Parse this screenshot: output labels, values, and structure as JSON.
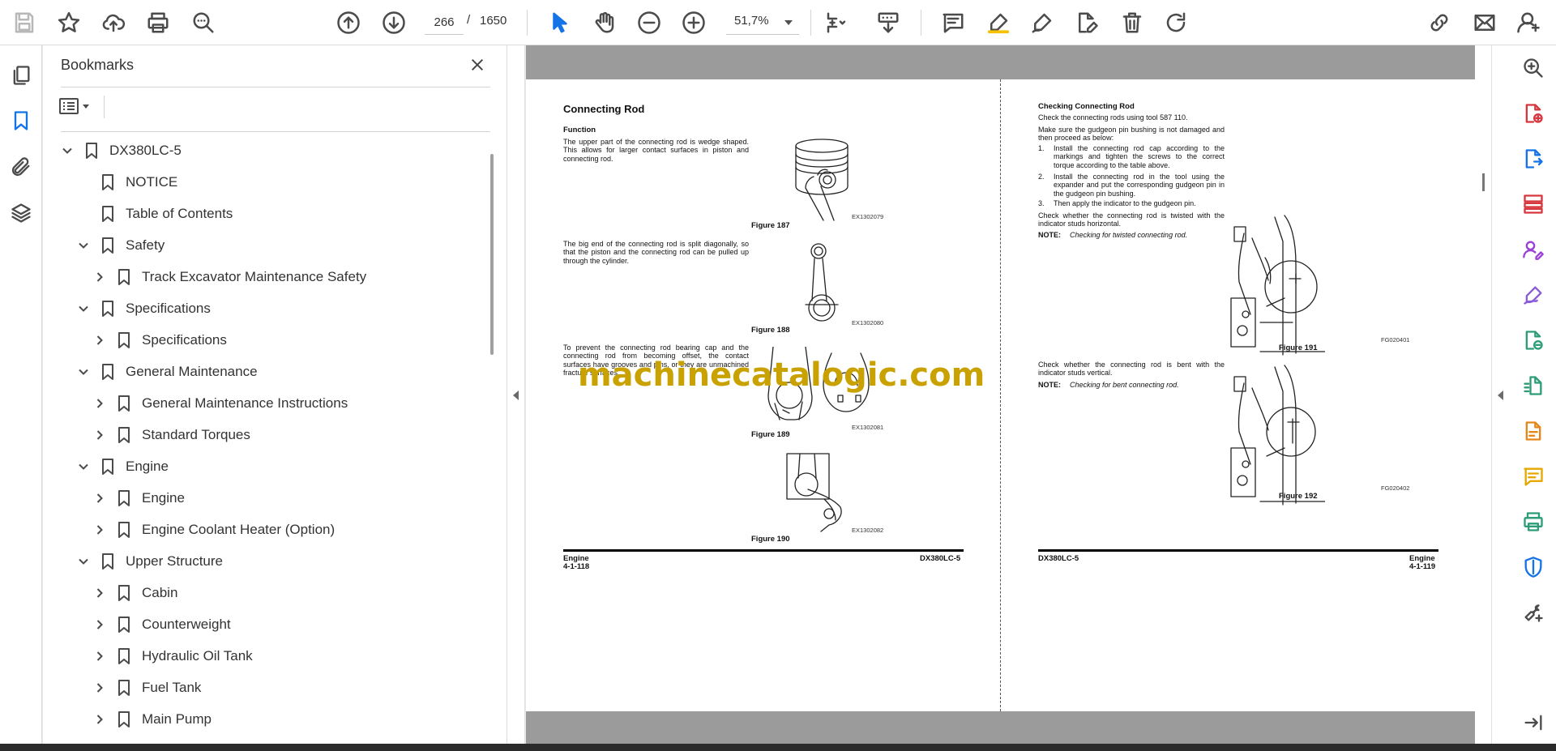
{
  "toolbar": {
    "page_current": "266",
    "page_separator": "/",
    "page_total": "1650",
    "zoom": "51,7%"
  },
  "bookmarks": {
    "title": "Bookmarks",
    "items": [
      {
        "label": "DX380LC-5",
        "level": 0,
        "expanded": true,
        "has_children": true
      },
      {
        "label": "NOTICE",
        "level": 1,
        "expanded": false,
        "has_children": false
      },
      {
        "label": "Table of Contents",
        "level": 1,
        "expanded": false,
        "has_children": false
      },
      {
        "label": "Safety",
        "level": 1,
        "expanded": true,
        "has_children": true
      },
      {
        "label": "Track Excavator Maintenance Safety",
        "level": 2,
        "expanded": false,
        "has_children": true
      },
      {
        "label": "Specifications",
        "level": 1,
        "expanded": true,
        "has_children": true
      },
      {
        "label": "Specifications",
        "level": 2,
        "expanded": false,
        "has_children": true
      },
      {
        "label": "General Maintenance",
        "level": 1,
        "expanded": true,
        "has_children": true
      },
      {
        "label": "General Maintenance Instructions",
        "level": 2,
        "expanded": false,
        "has_children": true
      },
      {
        "label": "Standard Torques",
        "level": 2,
        "expanded": false,
        "has_children": true
      },
      {
        "label": "Engine",
        "level": 1,
        "expanded": true,
        "has_children": true
      },
      {
        "label": "Engine",
        "level": 2,
        "expanded": false,
        "has_children": true
      },
      {
        "label": "Engine Coolant Heater (Option)",
        "level": 2,
        "expanded": false,
        "has_children": true
      },
      {
        "label": "Upper Structure",
        "level": 1,
        "expanded": true,
        "has_children": true
      },
      {
        "label": "Cabin",
        "level": 2,
        "expanded": false,
        "has_children": true
      },
      {
        "label": "Counterweight",
        "level": 2,
        "expanded": false,
        "has_children": true
      },
      {
        "label": "Hydraulic Oil Tank",
        "level": 2,
        "expanded": false,
        "has_children": true
      },
      {
        "label": "Fuel Tank",
        "level": 2,
        "expanded": false,
        "has_children": true
      },
      {
        "label": "Main Pump",
        "level": 2,
        "expanded": false,
        "has_children": true
      }
    ]
  },
  "left_page": {
    "title": "Connecting Rod",
    "function_heading": "Function",
    "para1": "The upper part of the connecting rod is wedge shaped. This allows for larger contact surfaces in piston and connecting rod.",
    "para2": "The big end of the connecting rod is split diagonally, so that the piston and the connecting rod can be pulled up through the cylinder.",
    "para3": "To prevent the connecting rod bearing cap and the connecting rod from becoming offset, the contact surfaces have grooves and pins, or they are unmachined fracture surfaces.",
    "fig187_caption": "Figure 187",
    "fig187_code": "EX1302079",
    "fig188_caption": "Figure 188",
    "fig188_code": "EX1302080",
    "fig189_caption": "Figure 189",
    "fig189_code": "EX1302081",
    "fig190_caption": "Figure 190",
    "fig190_code": "EX1302082",
    "footer_section": "Engine",
    "footer_page": "4-1-118",
    "footer_model": "DX380LC-5"
  },
  "right_page": {
    "heading": "Checking Connecting Rod",
    "intro": "Check the connecting rods using tool 587 110.",
    "para_bushing": "Make sure the gudgeon pin bushing is not damaged and then proceed as below:",
    "steps": [
      {
        "num": "1.",
        "text": "Install the connecting rod cap according to the markings and tighten the screws to the correct torque according to the table above."
      },
      {
        "num": "2.",
        "text": "Install the connecting rod in the tool using the expander and put the corresponding gudgeon pin in the gudgeon pin bushing."
      },
      {
        "num": "3.",
        "text": "Then apply the indicator to the gudgeon pin."
      }
    ],
    "check_twisted": "Check whether the connecting rod is twisted with the indicator studs horizontal.",
    "note1_label": "NOTE:",
    "note1_text": "Checking for twisted connecting rod.",
    "check_bent": "Check whether the connecting rod is bent with the indicator studs vertical.",
    "note2_label": "NOTE:",
    "note2_text": "Checking for bent connecting rod.",
    "fig191_caption": "Figure 191",
    "fig191_code": "FG020401",
    "fig192_caption": "Figure 192",
    "fig192_code": "FG020402",
    "footer_model": "DX380LC-5",
    "footer_section": "Engine",
    "footer_page": "4-1-119"
  },
  "watermark": "machinecatalogic.com",
  "colors": {
    "accent": "#1473e6",
    "watermark": "#c9a100",
    "doc_gray": "#9b9b9b",
    "right_rail_icons": [
      "#d7373f",
      "#1473e6",
      "#d7373f",
      "#9a3fd7",
      "#8a5bd8",
      "#2d9d78",
      "#2d9d78",
      "#e68619",
      "#e6a800",
      "#2d9d78",
      "#1473e6",
      "#4b4b4b"
    ]
  },
  "icons": {
    "toolbar": [
      "save-icon",
      "star-icon",
      "upload-icon",
      "print-icon",
      "zoom-search-icon",
      "arrow-up-icon",
      "arrow-down-icon",
      "select-arrow-icon",
      "hand-icon",
      "zoom-out-icon",
      "zoom-in-icon",
      "fit-page-icon",
      "scroll-mode-icon",
      "comment-icon",
      "highlight-icon",
      "sign-icon",
      "edit-pdf-icon",
      "trash-icon",
      "rotate-icon",
      "share-link-icon",
      "mail-icon",
      "account-icon"
    ],
    "left_rail": [
      "pages-icon",
      "bookmark-icon",
      "attachment-icon",
      "layers-icon"
    ],
    "right_rail": [
      "search-zoom-icon",
      "create-pdf-icon",
      "export-pdf-icon",
      "organize-pages-icon",
      "request-signature-icon",
      "fill-sign-icon",
      "compress-pdf-icon",
      "scan-ocr-icon",
      "export-file-icon",
      "comment-icon",
      "print-production-icon",
      "protect-icon",
      "more-tools-icon",
      "collapse-panel-icon"
    ]
  }
}
